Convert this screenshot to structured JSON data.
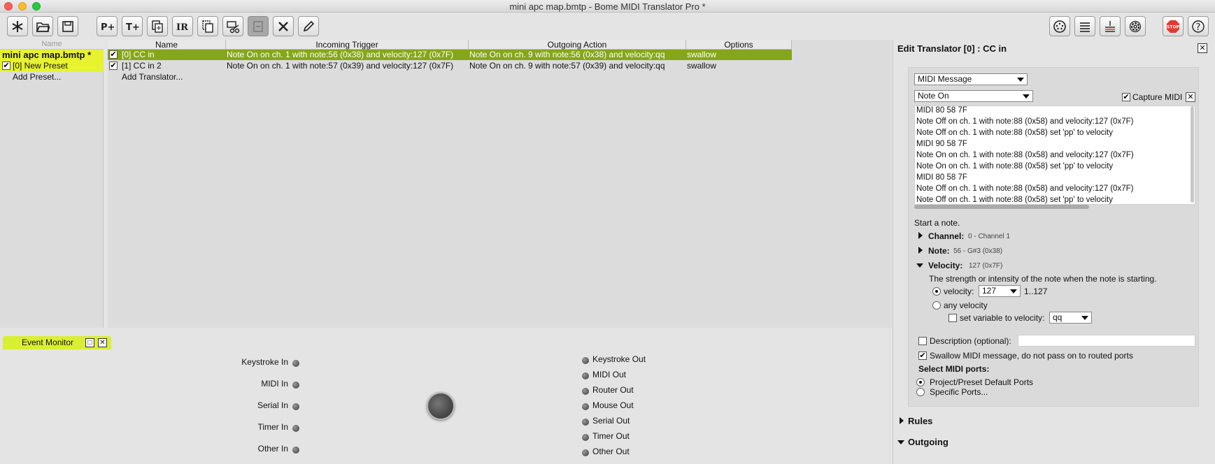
{
  "window": {
    "title": "mini apc map.bmtp - Bome MIDI Translator Pro *"
  },
  "presets": {
    "header": "Name",
    "project": "mini apc map.bmtp *",
    "items": [
      {
        "label": "[0] New Preset",
        "checked": true
      }
    ],
    "add_label": "Add Preset..."
  },
  "translators": {
    "columns": [
      "Name",
      "Incoming Trigger",
      "Outgoing Action",
      "Options"
    ],
    "rows": [
      {
        "name": "[0] CC in",
        "incoming": "Note On on ch. 1 with note:56 (0x38) and velocity:127 (0x7F)",
        "outgoing": "Note On on ch. 9 with note:56 (0x38) and velocity:qq",
        "options": "swallow"
      },
      {
        "name": "[1] CC in 2",
        "incoming": "Note On on ch. 1 with note:57 (0x39) and velocity:127 (0x7F)",
        "outgoing": "Note On on ch. 9 with note:57 (0x39) and velocity:qq",
        "options": "swallow"
      }
    ],
    "add_label": "Add Translator..."
  },
  "event_monitor": {
    "title": "Event Monitor",
    "inputs": [
      "Keystroke In",
      "MIDI In",
      "Serial In",
      "Timer In",
      "Other In"
    ],
    "outputs": [
      "Keystroke Out",
      "MIDI Out",
      "Router Out",
      "Mouse Out",
      "Serial Out",
      "Timer Out",
      "Other Out"
    ]
  },
  "editor": {
    "title": "Edit Translator [0] : CC in",
    "type_select": "MIDI Message",
    "message_select": "Note On",
    "capture_label": "Capture MIDI",
    "log": [
      "MIDI 80 58 7F",
      "Note Off on ch. 1 with note:88 (0x58) and velocity:127 (0x7F)",
      "Note Off on ch. 1 with note:88 (0x58) set 'pp' to velocity",
      "MIDI 90 58 7F",
      "Note On on ch. 1 with note:88 (0x58) and velocity:127 (0x7F)",
      "Note On on ch. 1 with note:88 (0x58) set 'pp' to velocity",
      "MIDI 80 58 7F",
      "Note Off on ch. 1 with note:88 (0x58) and velocity:127 (0x7F)",
      "Note Off on ch. 1 with note:88 (0x58) set 'pp' to velocity"
    ],
    "start_note": "Start a note.",
    "channel_label": "Channel:",
    "channel_value": "0 - Channel 1",
    "note_label": "Note:",
    "note_value": "56 - G#3 (0x38)",
    "velocity_label": "Velocity:",
    "velocity_value": "127 (0x7F)",
    "velocity_desc": "The strength or intensity of the note when the note is starting.",
    "velocity_option": "velocity:",
    "velocity_select": "127",
    "velocity_range": "1..127",
    "any_velocity": "any velocity",
    "set_variable": "set variable to velocity:",
    "variable_select": "qq",
    "description_label": "Description (optional):",
    "swallow_label": "Swallow MIDI message, do not pass on to routed ports",
    "ports_label": "Select MIDI ports:",
    "port_default": "Project/Preset Default Ports",
    "port_specific": "Specific Ports...",
    "rules_label": "Rules",
    "outgoing_label": "Outgoing"
  },
  "colors": {
    "selection_green": "#85a61a",
    "preset_yellow": "#e7f230",
    "stop_red": "#e03a2f"
  },
  "icons": {
    "toolbar_left": [
      "asterisk-icon",
      "folder-open-icon",
      "save-icon",
      "new-preset-icon",
      "new-translator-icon",
      "duplicate-icon",
      "rename-icon",
      "copy-icon",
      "cut-icon",
      "paste-icon",
      "delete-icon",
      "edit-icon"
    ],
    "toolbar_right": [
      "midi-port-icon",
      "list-icon",
      "routing-icon",
      "gear-icon",
      "stop-icon",
      "help-icon"
    ]
  }
}
